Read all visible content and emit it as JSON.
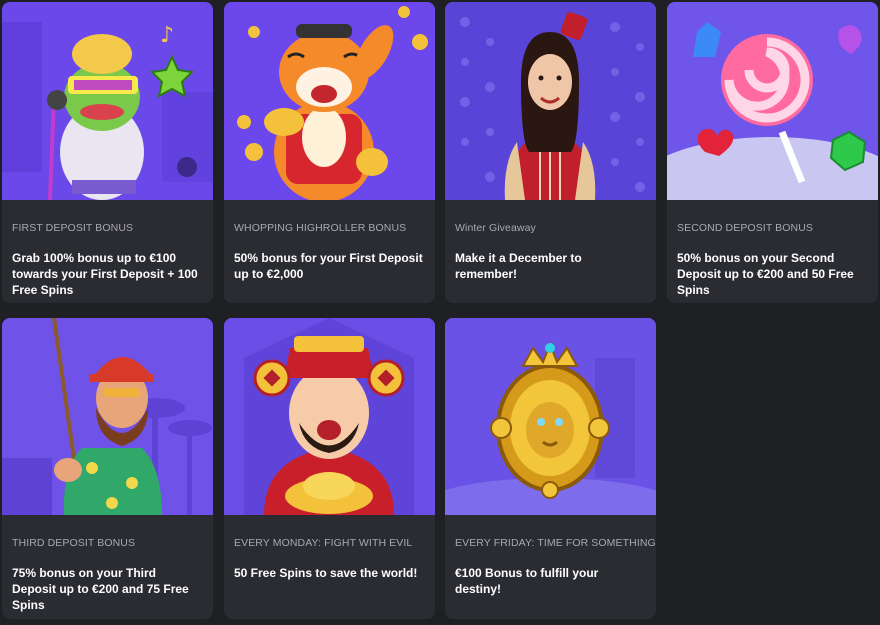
{
  "promotions": [
    {
      "category": "FIRST DEPOSIT BONUS",
      "description": "Grab 100% bonus up to €100 towards your First Deposit + 100 Free Spins",
      "image_icon": "frog-musician-icon"
    },
    {
      "category": "WHOPPING HIGHROLLER BONUS",
      "description": "50% bonus for your First Deposit up to €2,000",
      "image_icon": "tiger-mascot-icon"
    },
    {
      "category": "Winter Giveaway",
      "description": "Make it a December to remember!",
      "image_icon": "woman-host-icon"
    },
    {
      "category": "SECOND DEPOSIT BONUS",
      "description": "50% bonus on your Second Deposit up to €200 and 50 Free Spins",
      "image_icon": "candy-lollipop-icon"
    },
    {
      "category": "THIRD DEPOSIT BONUS",
      "description": "75% bonus on your Third Deposit up to €200 and 75 Free Spins",
      "image_icon": "fisherman-icon"
    },
    {
      "category": "EVERY MONDAY: FIGHT WITH EVIL",
      "description": "50 Free Spins to save the world!",
      "image_icon": "fortune-god-icon"
    },
    {
      "category": "EVERY FRIDAY: TIME FOR SOMETHING BIG",
      "description": "€100 Bonus to fulfill your destiny!",
      "image_icon": "golden-lion-emblem-icon"
    }
  ],
  "colors": {
    "page_background": "#1f2024",
    "card_background": "#2b2c31",
    "category_text": "#a8a9b0",
    "art_purple": "#5838d8"
  }
}
